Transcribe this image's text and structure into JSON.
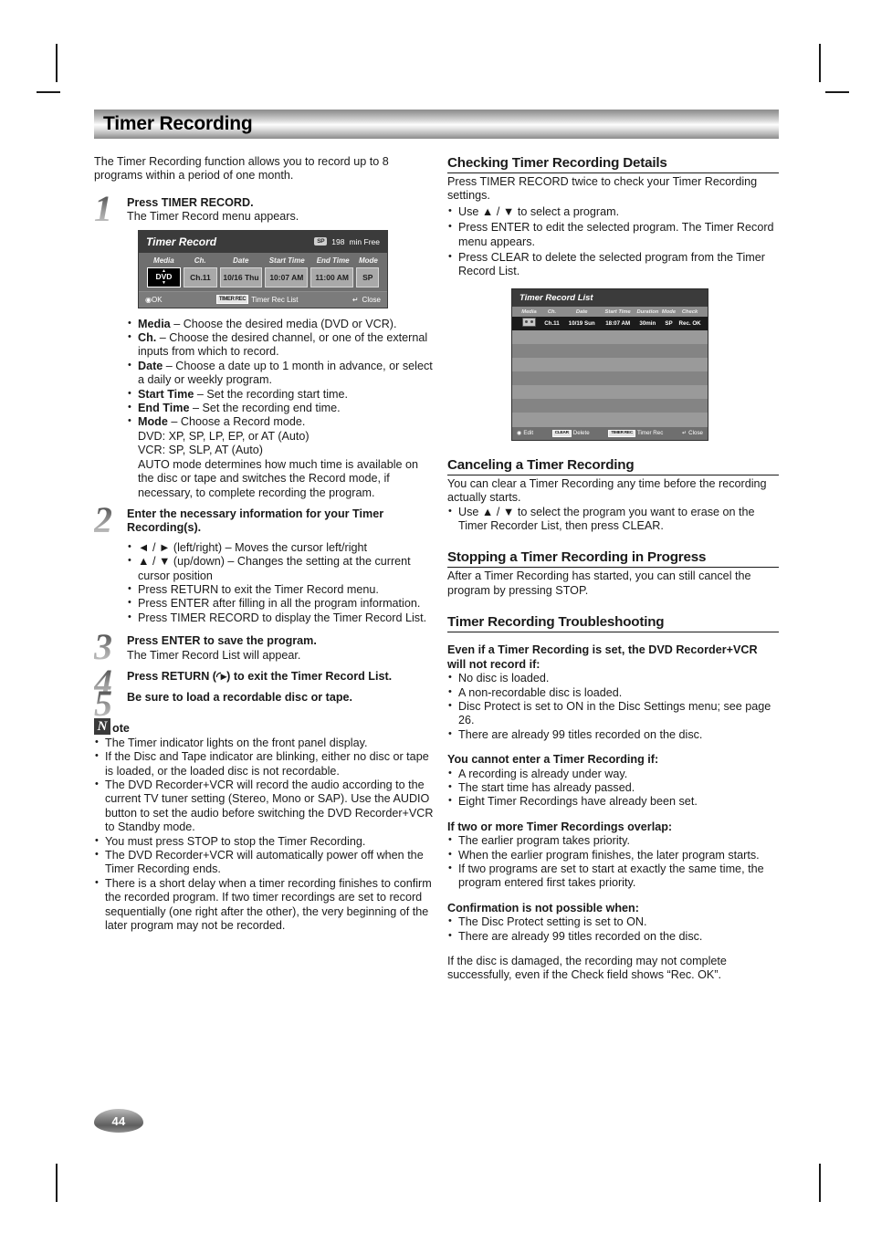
{
  "page": {
    "title": "Timer Recording",
    "number": "44"
  },
  "left": {
    "intro": "The Timer Recording function allows you to record up to 8 programs within a period of one month.",
    "steps": [
      {
        "num": "1",
        "head": "Press TIMER RECORD.",
        "sub": "The Timer Record menu appears."
      },
      {
        "num": "2",
        "head": "Enter the necessary information for your Timer Recording(s).",
        "sub": ""
      },
      {
        "num": "3",
        "head": "Press ENTER to save the program.",
        "sub": "The Timer Record List will appear."
      },
      {
        "num": "4",
        "head": "Press RETURN (◜▸) to exit the Timer Record List.",
        "sub": ""
      },
      {
        "num": "5",
        "head": "Be sure to load a recordable disc or tape.",
        "sub": ""
      }
    ],
    "field_bullets": [
      {
        "term": "Media",
        "rest": " – Choose the desired media (DVD or VCR)."
      },
      {
        "term": "Ch.",
        "rest": " – Choose the desired channel, or one of the external inputs from which to record."
      },
      {
        "term": "Date",
        "rest": " – Choose a date up to 1 month in advance, or select a daily or weekly program."
      },
      {
        "term": "Start Time",
        "rest": " – Set the recording start time."
      },
      {
        "term": "End Time",
        "rest": " – Set the recording end time."
      },
      {
        "term": "Mode",
        "rest": " – Choose a Record mode."
      }
    ],
    "mode_lines": [
      "DVD: XP, SP, LP, EP, or AT (Auto)",
      "VCR: SP, SLP, AT (Auto)",
      "AUTO mode determines how much time is available on the disc or tape and switches the Record mode, if necessary, to complete recording the program."
    ],
    "step2_bullets": [
      "◄ / ► (left/right) – Moves the cursor left/right",
      "▲ / ▼ (up/down) – Changes the setting at the current cursor position",
      "Press RETURN to exit the Timer Record menu.",
      "Press ENTER after filling in all the program information.",
      "Press TIMER RECORD to display the Timer Record List."
    ],
    "note": {
      "icon_letter": "N",
      "label": "ote",
      "items": [
        "The Timer indicator lights on the front panel display.",
        "If the Disc and Tape indicator are blinking, either no disc or tape is loaded, or the loaded disc is not recordable.",
        "The DVD Recorder+VCR will record the audio according to the current TV tuner setting (Stereo, Mono or SAP). Use the AUDIO button to set the audio before switching the DVD Recorder+VCR to Standby mode.",
        "You must press STOP to stop the Timer Recording.",
        "The DVD Recorder+VCR will automatically power off when the Timer Recording ends.",
        "There is a short delay when a timer recording finishes to confirm the recorded program. If two timer recordings are set to record sequentially (one right after the other), the very beginning of the later program may not be recorded."
      ]
    }
  },
  "osd_timer_record": {
    "title": "Timer Record",
    "mode_badge": "SP",
    "free_minutes": "198",
    "free_label": "min Free",
    "columns": [
      "Media",
      "Ch.",
      "Date",
      "Start Time",
      "End Time",
      "Mode"
    ],
    "values": [
      "DVD",
      "Ch.11",
      "10/16 Thu",
      "10:07 AM",
      "11:00 AM",
      "SP"
    ],
    "footer": {
      "ok": "OK",
      "trec_badge": "TIMER REC",
      "trec_label": "Timer Rec List",
      "close": "Close"
    }
  },
  "osd_timer_record_list": {
    "title": "Timer Record List",
    "columns": [
      "Media",
      "Ch.",
      "Date",
      "Start Time",
      "Duration",
      "Mode",
      "Check"
    ],
    "row": [
      "",
      "Ch.11",
      "10/19 Sun",
      "18:07 AM",
      "30min",
      "SP",
      "Rec. OK"
    ],
    "footer": {
      "edit": "Edit",
      "clear_badge": "CLEAR",
      "delete": "Delete",
      "trec_badge": "TIMER REC",
      "trec_label": "Timer Rec",
      "close": "Close"
    }
  },
  "right": {
    "sec1": {
      "heading": "Checking Timer Recording Details",
      "body": "Press TIMER RECORD twice to check your Timer Recording settings.",
      "bullets": [
        "Use ▲ / ▼ to select a program.",
        "Press ENTER to edit the selected program. The Timer Record menu appears.",
        "Press CLEAR to delete the selected program from the Timer Record List."
      ]
    },
    "sec2": {
      "heading": "Canceling a Timer Recording",
      "body": "You can clear a Timer Recording any time before the recording actually starts.",
      "bullets": [
        "Use ▲ / ▼ to select the program you want to erase on the Timer Recorder List, then press CLEAR."
      ]
    },
    "sec3": {
      "heading": "Stopping a Timer Recording in Progress",
      "body": "After a Timer Recording has started, you can still cancel the program by pressing STOP."
    },
    "sec4": {
      "heading": "Timer Recording Troubleshooting",
      "groups": [
        {
          "title": "Even if a Timer Recording is set, the DVD Recorder+VCR will not record if:",
          "items": [
            "No disc is loaded.",
            "A non-recordable disc is loaded.",
            "Disc Protect is set to ON in the Disc Settings menu; see page 26.",
            "There are already 99 titles recorded on the disc."
          ]
        },
        {
          "title": "You cannot enter a Timer Recording if:",
          "items": [
            "A recording is already under way.",
            "The start time has already passed.",
            "Eight Timer Recordings have already been set."
          ]
        },
        {
          "title": "If two or more Timer Recordings overlap:",
          "items": [
            "The earlier program takes priority.",
            "When the earlier program finishes, the later program starts.",
            "If two programs are set to start at exactly the same time, the program entered first takes priority."
          ]
        },
        {
          "title": "Confirmation is not possible when:",
          "items": [
            "The Disc Protect setting is set to ON.",
            "There are already 99 titles recorded on the disc."
          ]
        }
      ],
      "closing": "If the disc is damaged, the recording may not complete successfully, even if the Check field shows “Rec. OK”."
    }
  }
}
